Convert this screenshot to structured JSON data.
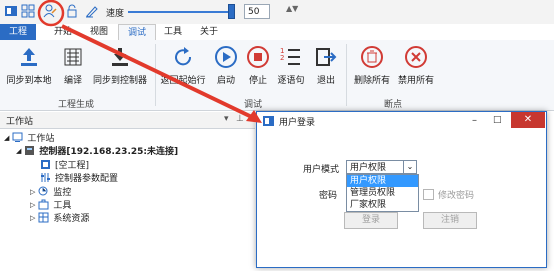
{
  "toolbar": {
    "speed_label": "速度",
    "speed_value": "50",
    "speed_level_percent": 50
  },
  "tabs": [
    {
      "label": "工程"
    },
    {
      "label": "开始"
    },
    {
      "label": "视图"
    },
    {
      "label": "调试"
    },
    {
      "label": "工具"
    },
    {
      "label": "关于"
    }
  ],
  "ribbon": {
    "sync_local": "同步到本地",
    "compile": "编译",
    "sync_controller": "同步到控制器",
    "group_project": "工程生成",
    "back_start": "返回起始行",
    "start": "启动",
    "stop": "停止",
    "step": "逐语句",
    "exit": "退出",
    "group_debug": "调试",
    "delete_all": "删除所有",
    "disable_all": "禁用所有",
    "group_breakpoint": "断点"
  },
  "workspace": {
    "title": "工作站",
    "root": "工作站",
    "controller": "控制器[192.168.23.25:未连接]",
    "empty_project": "[空工程]",
    "controller_params": "控制器参数配置",
    "monitor": "监控",
    "tools": "工具",
    "system_resources": "系统资源"
  },
  "dialog": {
    "title": "用户登录",
    "user_mode_label": "用户模式",
    "user_mode_value": "用户权限",
    "password_label": "密码",
    "options": [
      "用户权限",
      "管理员权限",
      "厂家权限"
    ],
    "change_password": "修改密码",
    "login": "登录",
    "logout": "注销"
  },
  "colors": {
    "accent": "#2b6cc4",
    "close": "#c7372f",
    "highlight_circle": "#e23a2c",
    "selection": "#3399ff"
  }
}
